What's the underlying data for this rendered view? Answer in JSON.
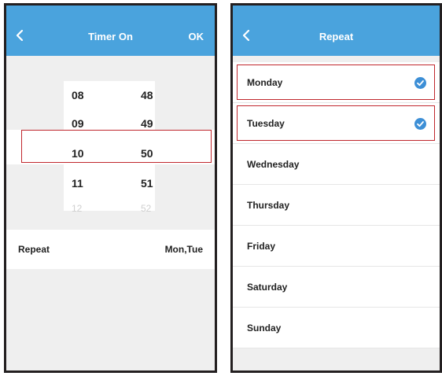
{
  "timer_screen": {
    "title": "Timer On",
    "ok_label": "OK",
    "back_icon": "chevron-left-icon",
    "picker": {
      "rows": [
        {
          "hour": "08",
          "minute": "48"
        },
        {
          "hour": "09",
          "minute": "49"
        },
        {
          "hour": "10",
          "minute": "50"
        },
        {
          "hour": "11",
          "minute": "51"
        },
        {
          "hour": "12",
          "minute": "52"
        }
      ],
      "selected_index": 2
    },
    "repeat_label": "Repeat",
    "repeat_value": "Mon,Tue"
  },
  "repeat_screen": {
    "title": "Repeat",
    "back_icon": "chevron-left-icon",
    "days": [
      {
        "label": "Monday",
        "checked": true
      },
      {
        "label": "Tuesday",
        "checked": true
      },
      {
        "label": "Wednesday",
        "checked": false
      },
      {
        "label": "Thursday",
        "checked": false
      },
      {
        "label": "Friday",
        "checked": false
      },
      {
        "label": "Saturday",
        "checked": false
      },
      {
        "label": "Sunday",
        "checked": false
      }
    ]
  },
  "colors": {
    "header": "#4aa3dd",
    "check": "#3d8fd6",
    "highlight": "#c0272d",
    "background": "#efefef"
  }
}
